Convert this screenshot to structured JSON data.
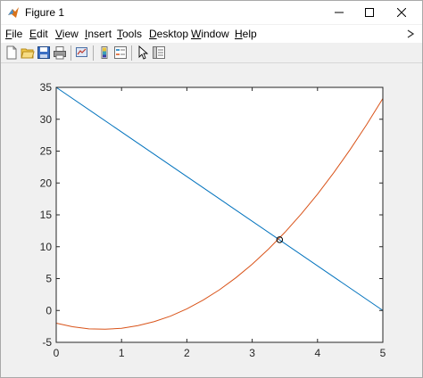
{
  "window": {
    "title": "Figure 1",
    "controls": {
      "minimize": "minimize",
      "maximize": "maximize",
      "close": "close"
    }
  },
  "menu": {
    "items": [
      "File",
      "Edit",
      "View",
      "Insert",
      "Tools",
      "Desktop",
      "Window",
      "Help"
    ]
  },
  "toolbar": {
    "buttons": [
      "new-figure-icon",
      "open-file-icon",
      "save-icon",
      "print-icon",
      "link-plot-icon",
      "colorbar-icon",
      "legend-icon",
      "edit-plot-cursor-icon",
      "property-inspector-icon"
    ]
  },
  "chart_data": {
    "type": "line",
    "title": "",
    "xlabel": "",
    "ylabel": "",
    "xlim": [
      0,
      5
    ],
    "ylim": [
      -5,
      35
    ],
    "xticks": [
      0,
      1,
      2,
      3,
      4,
      5
    ],
    "yticks": [
      -5,
      0,
      5,
      10,
      15,
      20,
      25,
      30,
      35
    ],
    "grid": false,
    "series": [
      {
        "color": "#0072BD",
        "x": [
          0,
          5
        ],
        "y": [
          35,
          0
        ]
      },
      {
        "color": "#D95319",
        "x": [
          0,
          0.25,
          0.5,
          0.75,
          1,
          1.25,
          1.5,
          1.75,
          2,
          2.25,
          2.5,
          2.75,
          3,
          3.25,
          3.5,
          3.75,
          4,
          4.25,
          4.5,
          4.75,
          5
        ],
        "y": [
          -2,
          -2.56,
          -2.88,
          -2.94,
          -2.8,
          -2.38,
          -1.75,
          -0.88,
          0.25,
          1.63,
          3.25,
          5.13,
          7.25,
          9.63,
          12.25,
          15.13,
          18.25,
          21.63,
          25.25,
          29.13,
          33.25
        ]
      }
    ],
    "markers": [
      {
        "x": 3.42,
        "y": 11.1,
        "shape": "circle",
        "color": "#000000"
      }
    ]
  }
}
